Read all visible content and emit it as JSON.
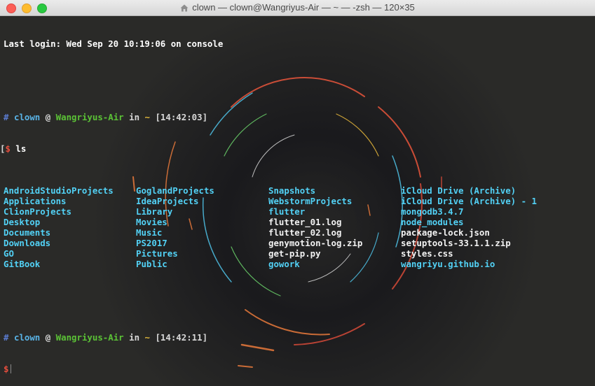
{
  "window": {
    "title": "clown — clown@Wangriyus-Air — ~ — -zsh — 120×35",
    "icon": "home-icon"
  },
  "terminal": {
    "last_login": "Last login: Wed Sep 20 10:19:06 on console",
    "prompt1": {
      "hash": "#",
      "user": "clown",
      "at": "@",
      "host": "Wangriyus-Air",
      "in": "in",
      "dir": "~",
      "time": "[14:42:03]",
      "bracket": "[",
      "dollar": "$",
      "command": "ls"
    },
    "ls_output": [
      {
        "name": "AndroidStudioProjects",
        "kind": "dir"
      },
      {
        "name": "GoglandProjects",
        "kind": "dir"
      },
      {
        "name": "Snapshots",
        "kind": "dir"
      },
      {
        "name": "iCloud Drive (Archive)",
        "kind": "dir"
      },
      {
        "name": "Applications",
        "kind": "dir"
      },
      {
        "name": "IdeaProjects",
        "kind": "dir"
      },
      {
        "name": "WebstormProjects",
        "kind": "dir"
      },
      {
        "name": "iCloud Drive (Archive) - 1",
        "kind": "dir"
      },
      {
        "name": "ClionProjects",
        "kind": "dir"
      },
      {
        "name": "Library",
        "kind": "dir"
      },
      {
        "name": "flutter",
        "kind": "dir"
      },
      {
        "name": "mongodb3.4.7",
        "kind": "dir"
      },
      {
        "name": "Desktop",
        "kind": "dir"
      },
      {
        "name": "Movies",
        "kind": "dir"
      },
      {
        "name": "flutter_01.log",
        "kind": "file"
      },
      {
        "name": "node_modules",
        "kind": "dir"
      },
      {
        "name": "Documents",
        "kind": "dir"
      },
      {
        "name": "Music",
        "kind": "dir"
      },
      {
        "name": "flutter_02.log",
        "kind": "file"
      },
      {
        "name": "package-lock.json",
        "kind": "file"
      },
      {
        "name": "Downloads",
        "kind": "dir"
      },
      {
        "name": "PS2017",
        "kind": "dir"
      },
      {
        "name": "genymotion-log.zip",
        "kind": "file"
      },
      {
        "name": "setuptools-33.1.1.zip",
        "kind": "file"
      },
      {
        "name": "GO",
        "kind": "dir"
      },
      {
        "name": "Pictures",
        "kind": "dir"
      },
      {
        "name": "get-pip.py",
        "kind": "file"
      },
      {
        "name": "styles.css",
        "kind": "file"
      },
      {
        "name": "GitBook",
        "kind": "dir"
      },
      {
        "name": "Public",
        "kind": "dir"
      },
      {
        "name": "gowork",
        "kind": "dir"
      },
      {
        "name": "wangriyu.github.io",
        "kind": "dir"
      }
    ],
    "prompt2": {
      "hash": "#",
      "user": "clown",
      "at": "@",
      "host": "Wangriyus-Air",
      "in": "in",
      "dir": "~",
      "time": "[14:42:11]",
      "dollar": "$"
    }
  },
  "colors": {
    "dir": "#52d1f5",
    "file": "#f2f2f2",
    "user": "#59b3e6",
    "host": "#5bc236",
    "dollar": "#e84e3e",
    "tilde": "#e2b93b"
  }
}
